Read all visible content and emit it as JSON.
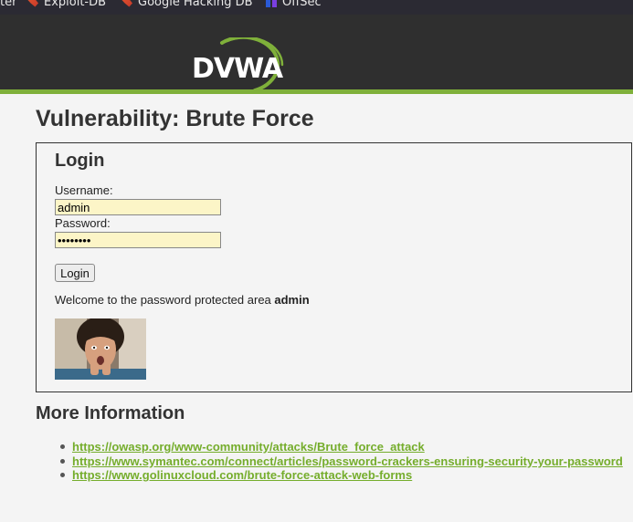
{
  "browser": {
    "bookmarks": [
      {
        "label": "ter"
      },
      {
        "label": "Exploit-DB",
        "icon": "kali-icon"
      },
      {
        "label": "Google Hacking DB",
        "icon": "kali-icon"
      },
      {
        "label": "OffSec",
        "icon": "offsec-icon"
      }
    ]
  },
  "header": {
    "logo_text": "DVWA",
    "accent_color": "#7fb03a"
  },
  "page": {
    "title": "Vulnerability: Brute Force"
  },
  "login": {
    "heading": "Login",
    "username_label": "Username:",
    "username_value": "admin",
    "password_label": "Password:",
    "password_value": "password",
    "submit_label": "Login",
    "welcome_text": "Welcome to the password protected area ",
    "welcome_user": "admin"
  },
  "more_info": {
    "heading": "More Information",
    "links": [
      "https://owasp.org/www-community/attacks/Brute_force_attack",
      "https://www.symantec.com/connect/articles/password-crackers-ensuring-security-your-password",
      "https://www.golinuxcloud.com/brute-force-attack-web-forms"
    ]
  }
}
